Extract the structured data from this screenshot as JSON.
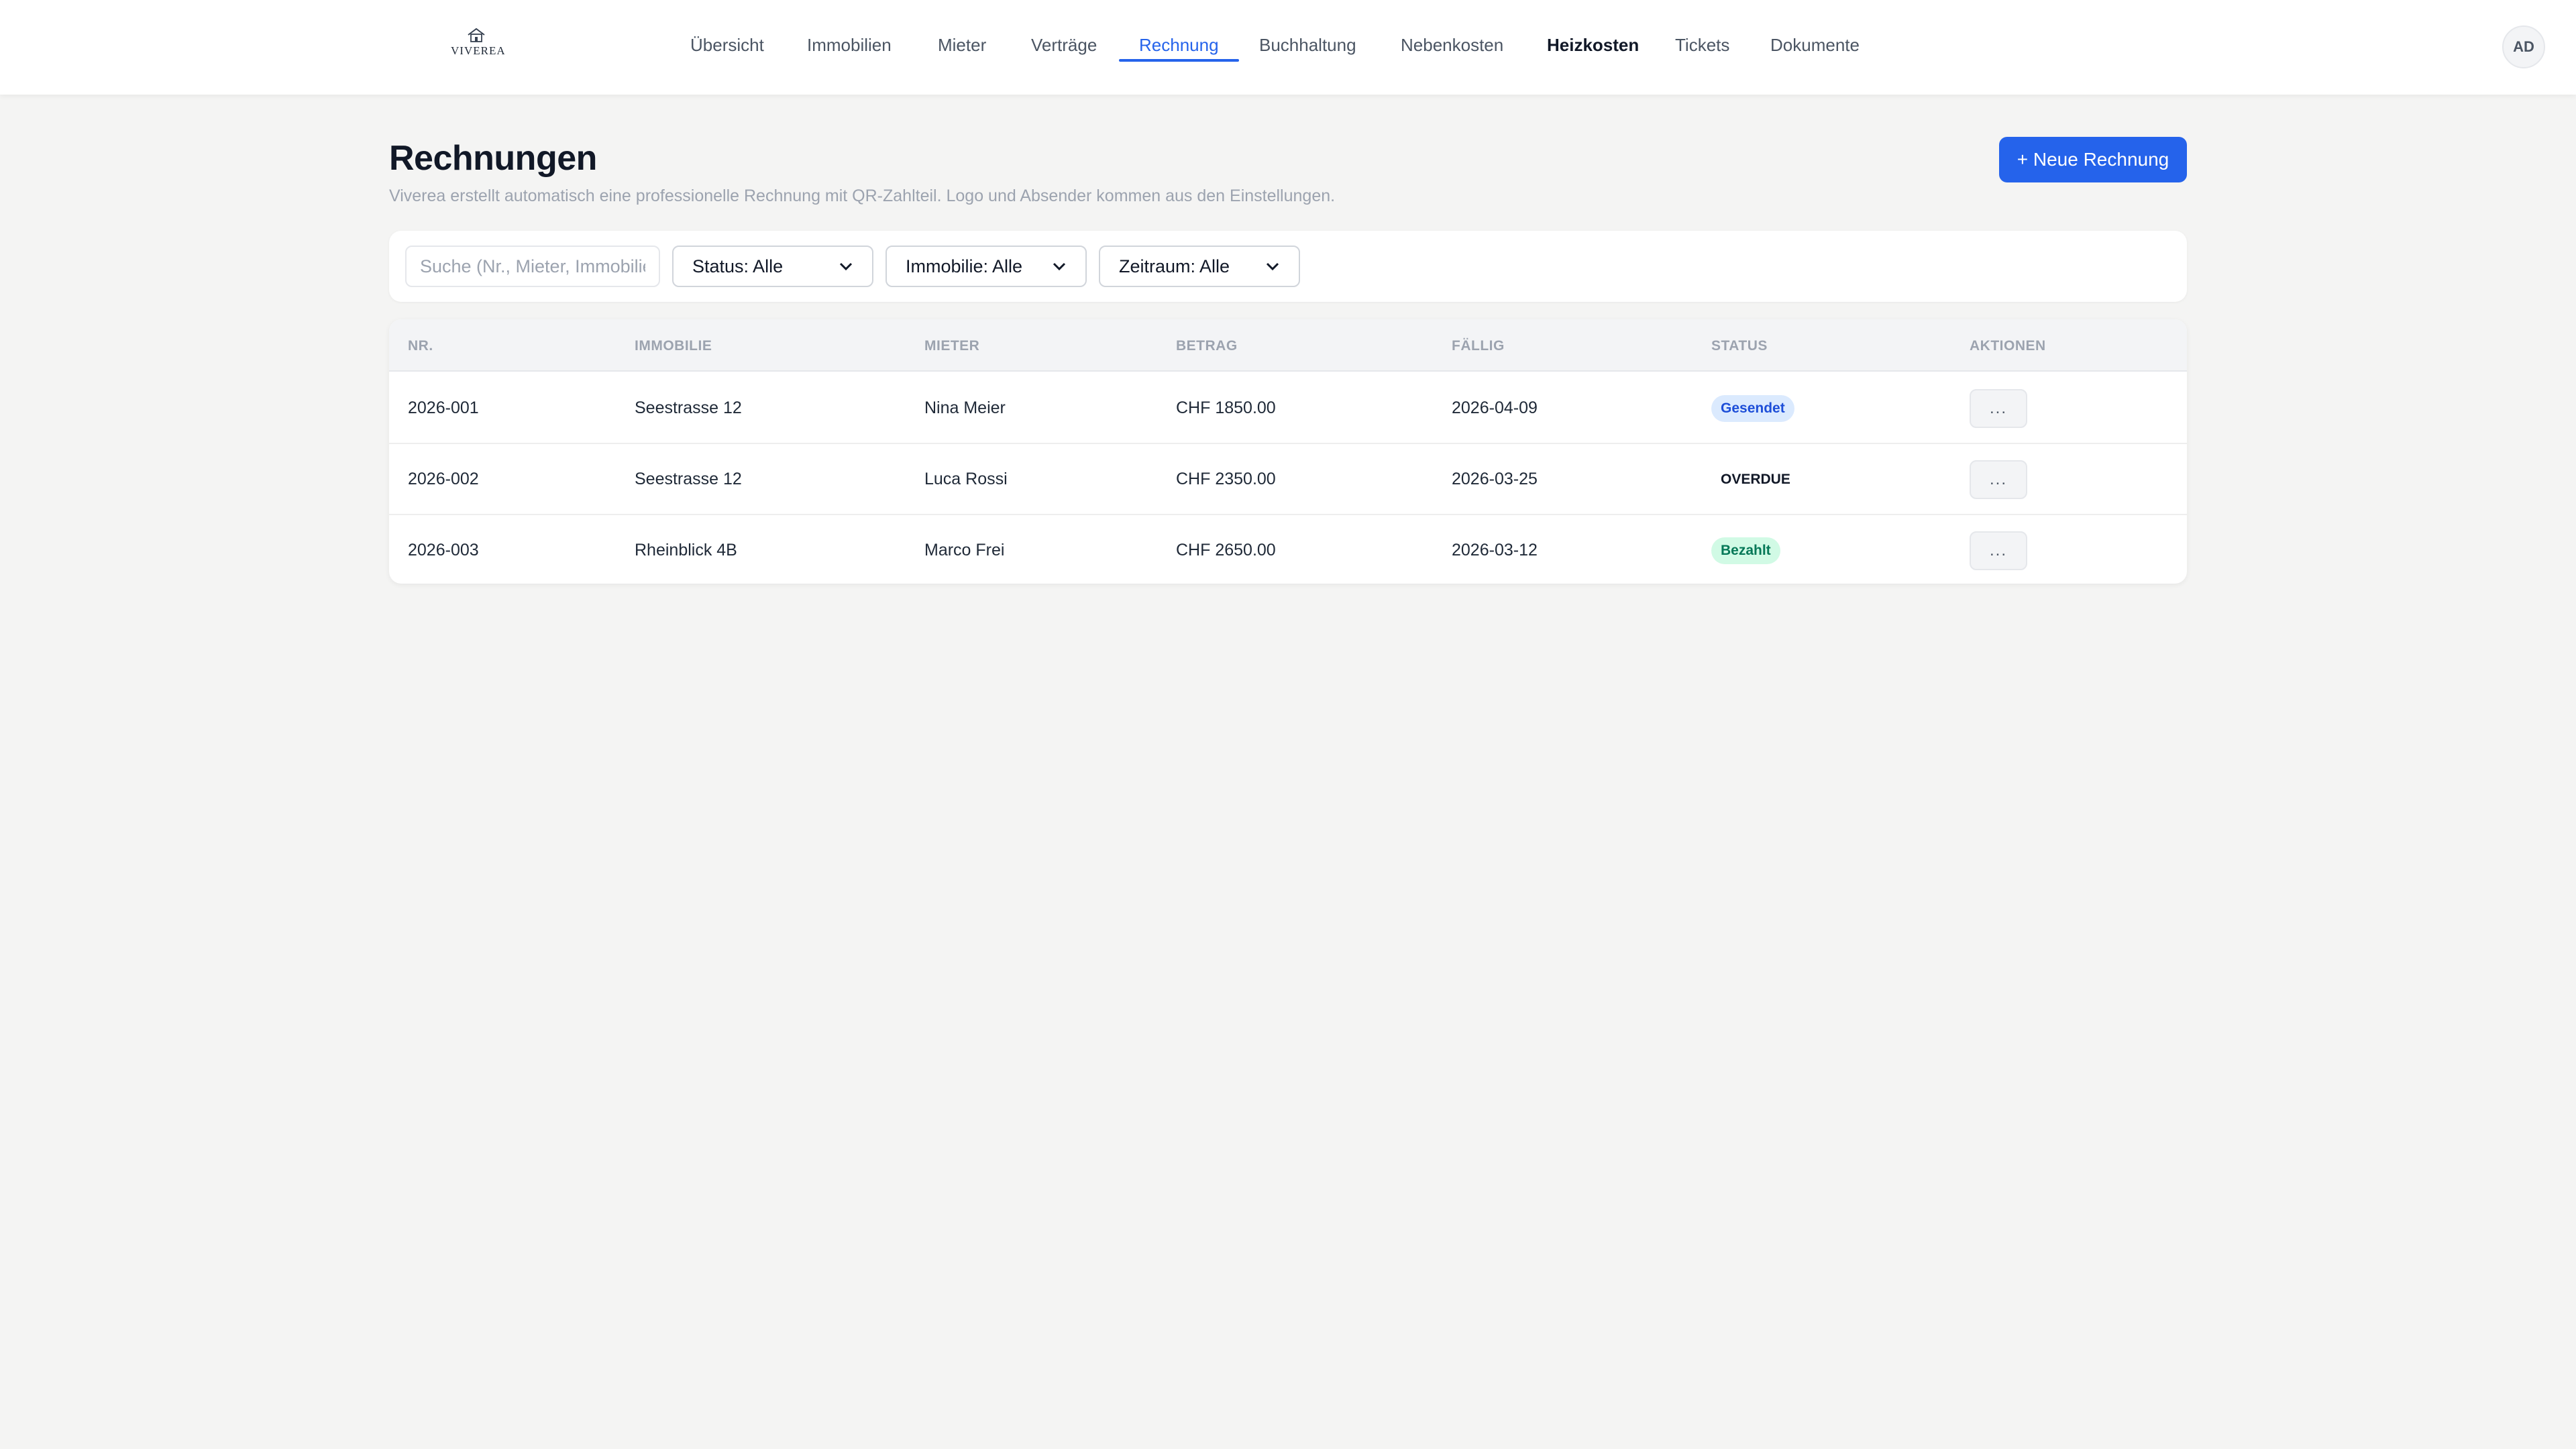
{
  "brand": {
    "name": "VIVEREA"
  },
  "nav": {
    "items": [
      {
        "label": "Übersicht"
      },
      {
        "label": "Immobilien"
      },
      {
        "label": "Mieter"
      },
      {
        "label": "Verträge"
      },
      {
        "label": "Rechnung",
        "active": true
      },
      {
        "label": "Buchhaltung"
      },
      {
        "label": "Nebenkosten"
      },
      {
        "label": "Heizkosten"
      },
      {
        "label": "Tickets"
      },
      {
        "label": "Dokumente"
      }
    ]
  },
  "user": {
    "initials": "AD"
  },
  "page": {
    "title": "Rechnungen",
    "subtitle": "Viverea erstellt automatisch eine professionelle Rechnung mit QR-Zahlteil. Logo und Absender kommen aus den Einstellungen.",
    "new_button_label": "+ Neue Rechnung"
  },
  "filters": {
    "search_placeholder": "Suche (Nr., Mieter, Immobilie)",
    "status": "Status: Alle",
    "property": "Immobilie: Alle",
    "period": "Zeitraum: Alle"
  },
  "table": {
    "columns": [
      "NR.",
      "IMMOBILIE",
      "MIETER",
      "BETRAG",
      "FÄLLIG",
      "STATUS",
      "AKTIONEN"
    ],
    "rows": [
      {
        "nr": "2026-001",
        "property": "Seestrasse 12",
        "tenant": "Nina Meier",
        "amount": "CHF 1850.00",
        "due": "2026-04-09",
        "status": "Gesendet",
        "action": "..."
      },
      {
        "nr": "2026-002",
        "property": "Seestrasse 12",
        "tenant": "Luca Rossi",
        "amount": "CHF 2350.00",
        "due": "2026-03-25",
        "status": "OVERDUE",
        "action": "..."
      },
      {
        "nr": "2026-003",
        "property": "Rheinblick 4B",
        "tenant": "Marco Frei",
        "amount": "CHF 2650.00",
        "due": "2026-03-12",
        "status": "Bezahlt",
        "action": "..."
      }
    ]
  },
  "colors": {
    "accent": "#2563eb",
    "background": "#f4f4f3",
    "status_sent_bg": "#dbeafe",
    "status_paid_bg": "#d1fae5"
  }
}
